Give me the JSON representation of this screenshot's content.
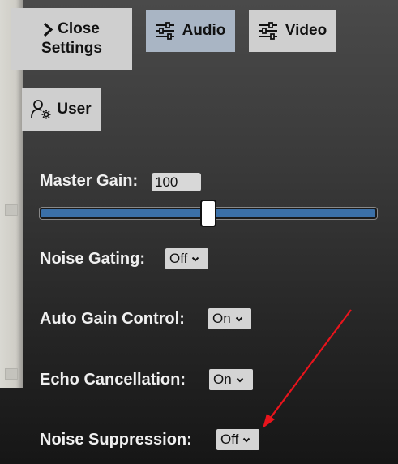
{
  "nav": {
    "close_line1": "Close",
    "close_line2": "Settings",
    "audio_label": "Audio",
    "video_label": "Video",
    "user_label": "User"
  },
  "audio_settings": {
    "master_gain_label": "Master Gain:",
    "master_gain_value": "100",
    "noise_gating_label": "Noise Gating:",
    "noise_gating_value": "Off",
    "auto_gain_label": "Auto Gain Control:",
    "auto_gain_value": "On",
    "echo_cancellation_label": "Echo Cancellation:",
    "echo_cancellation_value": "On",
    "noise_suppression_label": "Noise Suppression:",
    "noise_suppression_value": "Off"
  },
  "colors": {
    "active_tab": "#a9b5c4",
    "inactive_tab": "#cfcfcf",
    "slider_fill": "#3b70a8",
    "annotation_arrow": "#e8141c"
  },
  "icons": {
    "close": "chevron-right-icon",
    "audio": "sliders-icon",
    "video": "sliders-icon",
    "user": "user-gear-icon"
  }
}
